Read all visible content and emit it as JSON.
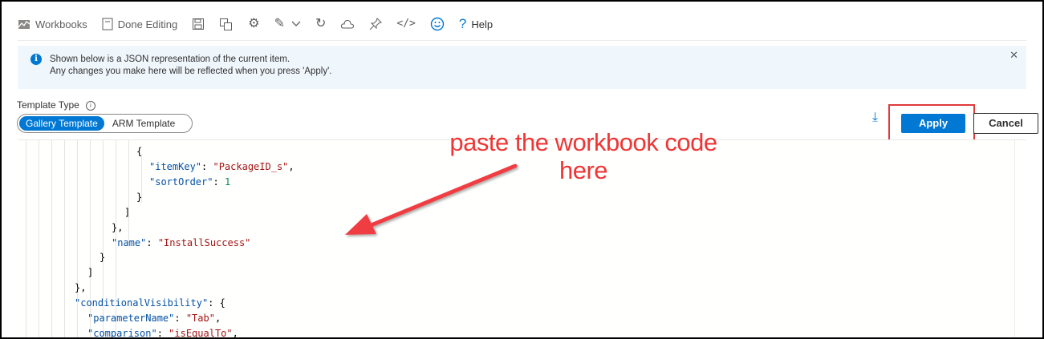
{
  "toolbar": {
    "workbooks_label": "Workbooks",
    "done_editing_label": "Done Editing",
    "help_label": "Help"
  },
  "info": {
    "line1": "Shown below is a JSON representation of the current item.",
    "line2": "Any changes you make here will be reflected when you press 'Apply'."
  },
  "template_type": {
    "label": "Template Type",
    "options": [
      "Gallery Template",
      "ARM Template"
    ],
    "selected": "Gallery Template"
  },
  "actions": {
    "apply_label": "Apply",
    "cancel_label": "Cancel"
  },
  "annotation": {
    "line1": "paste the workbook code",
    "line2": "here"
  },
  "code": {
    "l1_open": "{",
    "l2_key": "\"itemKey\"",
    "l2_val": "\"PackageID_s\"",
    "l3_key": "\"sortOrder\"",
    "l3_val": "1",
    "l4": "}",
    "l5": "]",
    "l6": "},",
    "l7_key": "\"name\"",
    "l7_val": "\"InstallSuccess\"",
    "l8": "}",
    "l9": "]",
    "l10": "},",
    "l11_key": "\"conditionalVisibility\"",
    "l12_key": "\"parameterName\"",
    "l12_val": "\"Tab\"",
    "l13_key": "\"comparison\"",
    "l13_val": "\"isEqualTo\""
  },
  "colors": {
    "accent": "#0078d4",
    "annotation_red": "#ee3636"
  }
}
